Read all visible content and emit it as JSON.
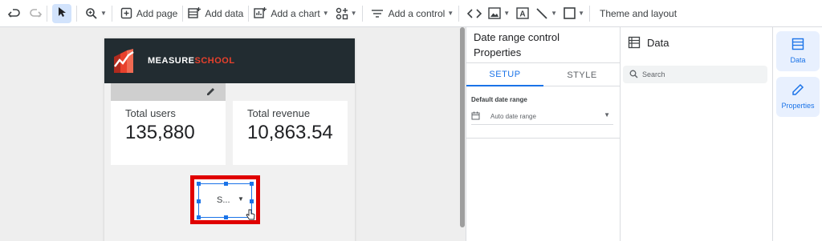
{
  "toolbar": {
    "add_page": "Add page",
    "add_data": "Add data",
    "add_chart": "Add a chart",
    "add_control": "Add a control",
    "theme": "Theme and layout"
  },
  "report": {
    "logo_text_a": "MEASURE",
    "logo_text_b": "SCHOOL",
    "kpi": [
      {
        "label": "Total users",
        "value": "135,880"
      },
      {
        "label": "Total revenue",
        "value": "10,863.54"
      }
    ],
    "control_text": "S..."
  },
  "properties": {
    "title_line1": "Date range control",
    "title_line2": "Properties",
    "tab_setup": "SETUP",
    "tab_style": "STYLE",
    "default_date_label": "Default date range",
    "date_value": "Auto date range"
  },
  "data_panel": {
    "title": "Data",
    "search_placeholder": "Search"
  },
  "rail": {
    "data_label": "Data",
    "properties_label": "Properties"
  },
  "colors": {
    "accent": "#1a73e8",
    "selection_highlight": "#e00000",
    "header_bg": "#222c31",
    "logo_red": "#e8412c"
  }
}
